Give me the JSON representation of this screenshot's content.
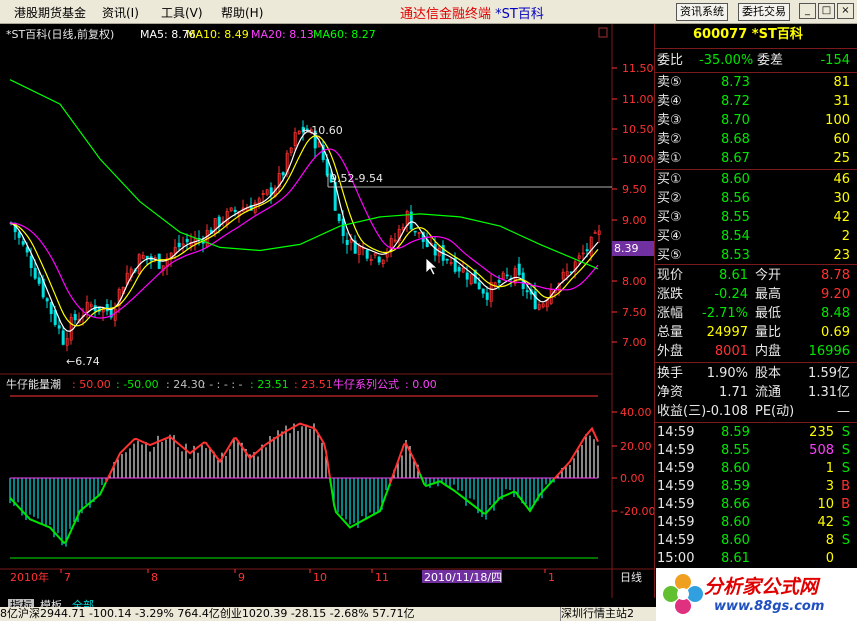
{
  "menu": {
    "items": [
      "港股期货基金",
      "资讯(I)",
      "工具(V)",
      "帮助(H)"
    ]
  },
  "app": {
    "title": "通达信金融终端",
    "stock_short": "*ST百科"
  },
  "toolbar": {
    "info_system": "资讯系统",
    "trade": "委托交易"
  },
  "window_controls": {
    "minimize": "_",
    "maximize": "□",
    "close": "×"
  },
  "main_chart": {
    "header_name": "*ST百科(日线,前复权)",
    "ma5": "MA5: 8.76",
    "ma10": "MA10: 8.49",
    "ma20": "MA20: 8.13",
    "ma60": "MA60: 8.27",
    "y_ticks": [
      "11.50",
      "11.00",
      "10.50",
      "10.00",
      "9.50",
      "9.00",
      "8.50",
      "8.00",
      "7.50",
      "7.00"
    ],
    "current_price_tag": "8.39",
    "annotation_high": "10.60",
    "annotation_low": "6.74",
    "annotation_range": "9.52-9.54"
  },
  "indicator": {
    "name": "牛仔能量潮",
    "v1": ": 50.00",
    "v2": ": -50.00",
    "v3": ": 24.30",
    "v4": ": - : - : -",
    "v5": ": 23.51",
    "v6": ": 23.51",
    "formula_label": "牛仔系列公式",
    "formula_value": ": 0.00",
    "y_ticks": [
      "40.00",
      "20.00",
      "0.00",
      "-20.00"
    ]
  },
  "date_axis": {
    "labels": [
      "2010年",
      "7",
      "8",
      "9",
      "10",
      "11",
      "2010/11/18/四",
      "1"
    ],
    "period": "日线"
  },
  "chart_data": [
    {
      "type": "line",
      "title": "*ST百科(日线,前复权)",
      "ylim": [
        6.6,
        11.8
      ],
      "series": [
        {
          "name": "MA5",
          "color": "#ffffff"
        },
        {
          "name": "MA10",
          "color": "#ffff00"
        },
        {
          "name": "MA20",
          "color": "#ff00ff"
        },
        {
          "name": "MA60",
          "color": "#00ff00"
        }
      ],
      "price_marks": {
        "high": 10.6,
        "low": 6.74,
        "ref": "9.52-9.54",
        "last": 8.39
      }
    },
    {
      "type": "bar",
      "title": "牛仔能量潮",
      "ylim": [
        -50,
        50
      ],
      "bar_colors": {
        "up": "#ff3232",
        "down": "#00e0e0"
      }
    }
  ],
  "quote": {
    "code_name": "600077 *ST百科",
    "weibi_label": "委比",
    "weibi_value": "-35.00%",
    "weicha_label": "委差",
    "weicha_value": "-154",
    "asks": [
      {
        "label": "卖⑤",
        "price": "8.73",
        "vol": "81"
      },
      {
        "label": "卖④",
        "price": "8.72",
        "vol": "31"
      },
      {
        "label": "卖③",
        "price": "8.70",
        "vol": "100"
      },
      {
        "label": "卖②",
        "price": "8.68",
        "vol": "60"
      },
      {
        "label": "卖①",
        "price": "8.67",
        "vol": "25"
      }
    ],
    "bids": [
      {
        "label": "买①",
        "price": "8.60",
        "vol": "46"
      },
      {
        "label": "买②",
        "price": "8.56",
        "vol": "30"
      },
      {
        "label": "买③",
        "price": "8.55",
        "vol": "42"
      },
      {
        "label": "买④",
        "price": "8.54",
        "vol": "2"
      },
      {
        "label": "买⑤",
        "price": "8.53",
        "vol": "23"
      }
    ],
    "stats": [
      {
        "l1": "现价",
        "v1": "8.61",
        "l2": "今开",
        "v2": "8.78",
        "c1": "green",
        "c2": "red"
      },
      {
        "l1": "涨跌",
        "v1": "-0.24",
        "l2": "最高",
        "v2": "9.20",
        "c1": "green",
        "c2": "red"
      },
      {
        "l1": "涨幅",
        "v1": "-2.71%",
        "l2": "最低",
        "v2": "8.48",
        "c1": "green",
        "c2": "green"
      },
      {
        "l1": "总量",
        "v1": "24997",
        "l2": "量比",
        "v2": "0.69",
        "c1": "yellow",
        "c2": "yellow"
      },
      {
        "l1": "外盘",
        "v1": "8001",
        "l2": "内盘",
        "v2": "16996",
        "c1": "red",
        "c2": "green"
      }
    ],
    "fundamentals": [
      {
        "l1": "换手",
        "v1": "1.90%",
        "l2": "股本",
        "v2": "1.59亿"
      },
      {
        "l1": "净资",
        "v1": "1.71",
        "l2": "流通",
        "v2": "1.31亿"
      },
      {
        "l1": "收益(三)",
        "v1": "-0.108",
        "l2": "PE(动)",
        "v2": "—"
      }
    ],
    "ticks": [
      {
        "time": "14:59",
        "price": "8.59",
        "vol": "235",
        "bs": "S",
        "pc": "green",
        "vc": "yellow",
        "bc": "green"
      },
      {
        "time": "14:59",
        "price": "8.55",
        "vol": "508",
        "bs": "S",
        "pc": "green",
        "vc": "mag",
        "bc": "green"
      },
      {
        "time": "14:59",
        "price": "8.60",
        "vol": "1",
        "bs": "S",
        "pc": "green",
        "vc": "yellow",
        "bc": "green"
      },
      {
        "time": "14:59",
        "price": "8.59",
        "vol": "3",
        "bs": "B",
        "pc": "green",
        "vc": "yellow",
        "bc": "red"
      },
      {
        "time": "14:59",
        "price": "8.66",
        "vol": "10",
        "bs": "B",
        "pc": "green",
        "vc": "yellow",
        "bc": "red"
      },
      {
        "time": "14:59",
        "price": "8.60",
        "vol": "42",
        "bs": "S",
        "pc": "green",
        "vc": "yellow",
        "bc": "green"
      },
      {
        "time": "14:59",
        "price": "8.60",
        "vol": "8",
        "bs": "S",
        "pc": "green",
        "vc": "yellow",
        "bc": "green"
      },
      {
        "time": "15:00",
        "price": "8.61",
        "vol": "0",
        "bs": "",
        "pc": "green",
        "vc": "yellow",
        "bc": "green"
      }
    ]
  },
  "bottom": {
    "tabs": [
      "指标",
      "模板",
      "全部"
    ],
    "ticker": "8亿沪深2944.71 -100.14 -3.29% 764.4亿创业1020.39 -28.15 -2.68% 57.71亿",
    "market_station": "深圳行情主站2"
  },
  "logo": {
    "line1": "分析家公式网",
    "line2": "www.88gs.com"
  }
}
